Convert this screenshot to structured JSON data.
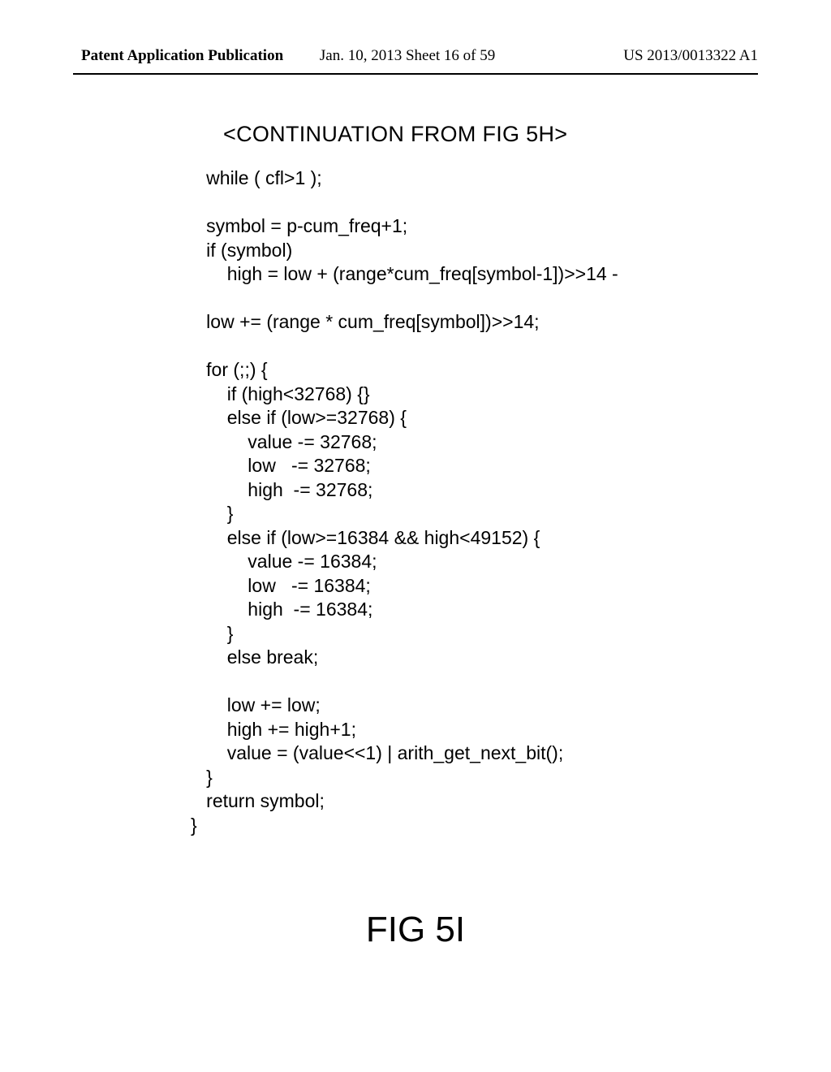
{
  "header": {
    "left": "Patent Application Publication",
    "center": "Jan. 10, 2013  Sheet 16 of 59",
    "right": "US 2013/0013322 A1"
  },
  "continuation": "<CONTINUATION FROM FIG 5H>",
  "code": "   while ( cfl>1 );\n\n   symbol = p-cum_freq+1;\n   if (symbol)\n       high = low + (range*cum_freq[symbol-1])>>14 - \n\n   low += (range * cum_freq[symbol])>>14;\n\n   for (;;) {\n       if (high<32768) {}\n       else if (low>=32768) {\n           value -= 32768;\n           low   -= 32768;\n           high  -= 32768;\n       }\n       else if (low>=16384 && high<49152) {\n           value -= 16384;\n           low   -= 16384;\n           high  -= 16384;\n       }\n       else break;\n\n       low += low;\n       high += high+1;\n       value = (value<<1) | arith_get_next_bit();\n   }\n   return symbol;\n}",
  "figure_label": "FIG 5I"
}
